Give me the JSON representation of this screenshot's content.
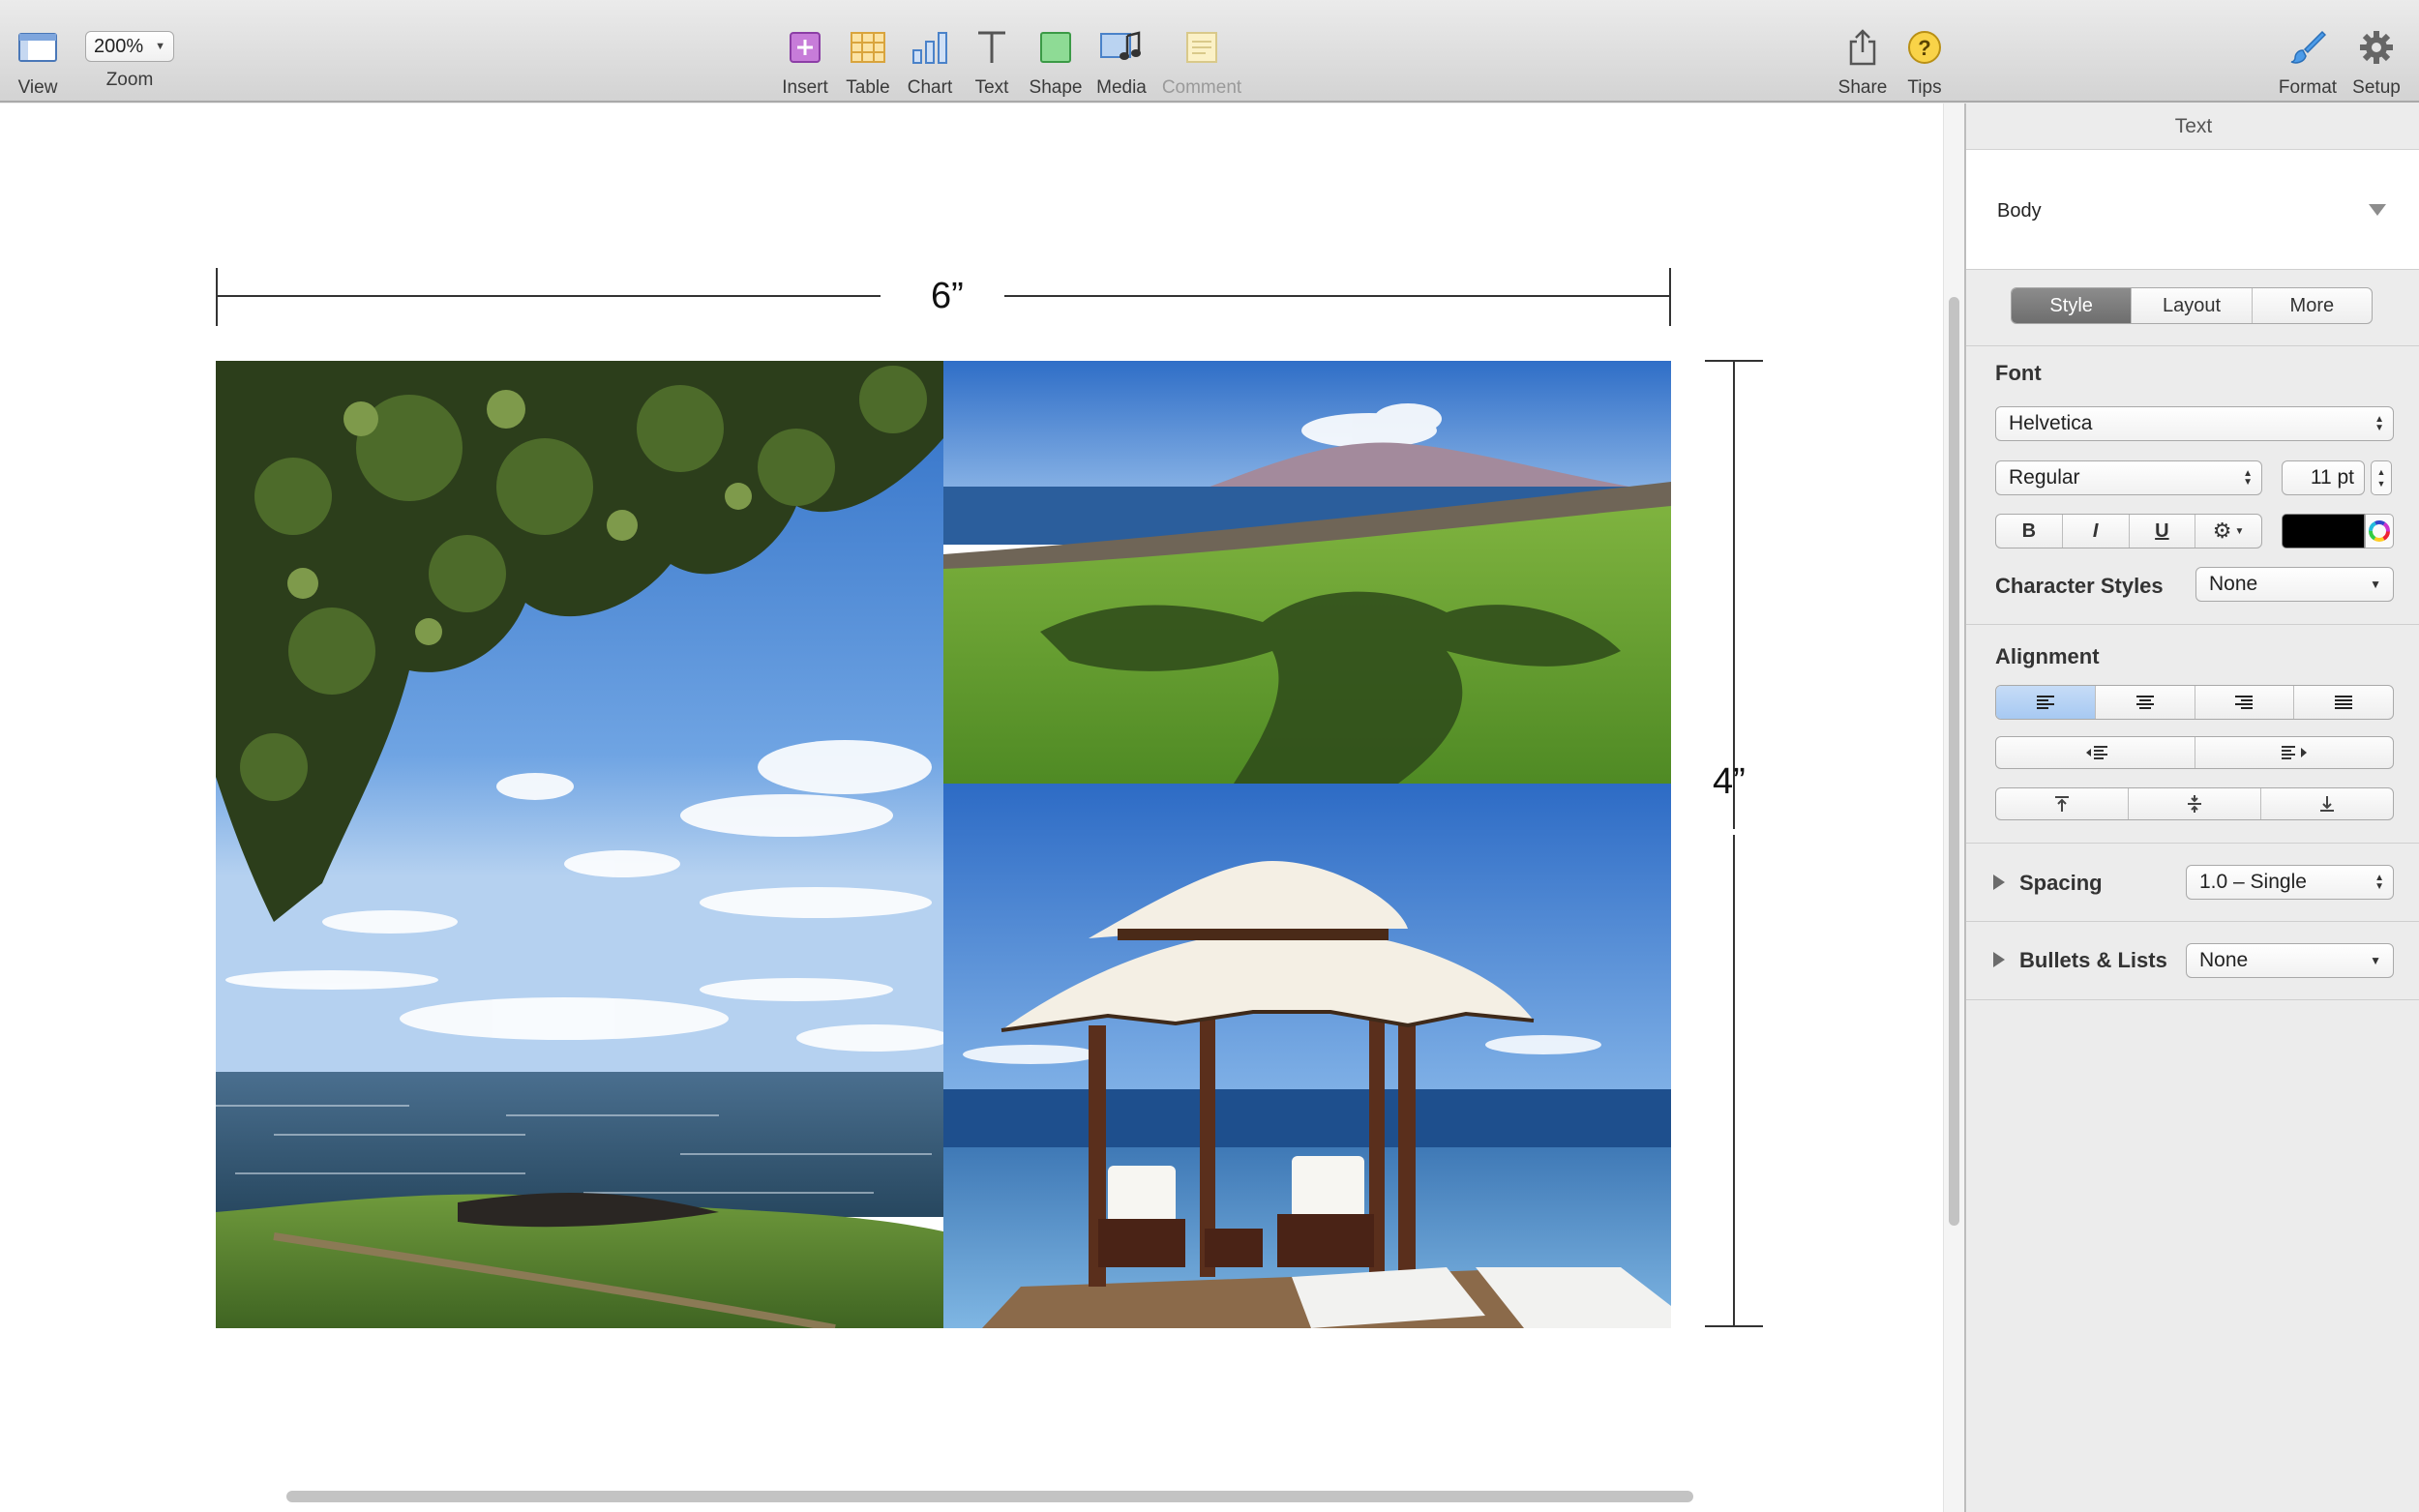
{
  "toolbar": {
    "view_label": "View",
    "zoom_label": "Zoom",
    "zoom_value": "200%",
    "insert_label": "Insert",
    "table_label": "Table",
    "chart_label": "Chart",
    "text_label": "Text",
    "shape_label": "Shape",
    "media_label": "Media",
    "comment_label": "Comment",
    "share_label": "Share",
    "tips_label": "Tips",
    "format_label": "Format",
    "setup_label": "Setup"
  },
  "canvas": {
    "width_dimension": "6”",
    "height_dimension": "4”"
  },
  "inspector": {
    "title": "Text",
    "paragraph_style": "Body",
    "tabs": [
      "Style",
      "Layout",
      "More"
    ],
    "active_tab": "Style",
    "font_heading": "Font",
    "font_family": "Helvetica",
    "font_typeface": "Regular",
    "font_size": "11 pt",
    "bold": "B",
    "italic": "I",
    "underline": "U",
    "text_color": "#000000",
    "character_styles_label": "Character Styles",
    "character_styles_value": "None",
    "alignment_heading": "Alignment",
    "spacing_label": "Spacing",
    "spacing_value": "1.0 – Single",
    "bullets_label": "Bullets & Lists",
    "bullets_value": "None"
  }
}
